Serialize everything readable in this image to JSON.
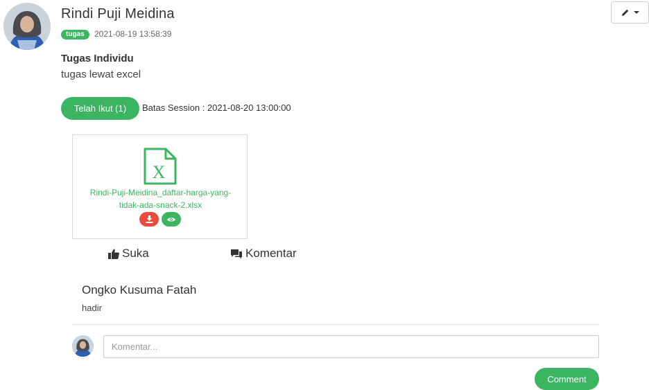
{
  "post": {
    "author": "Rindi Puji Meidina",
    "badge": "tugas",
    "timestamp": "2021-08-19 13:58:39",
    "title": "Tugas Individu",
    "body": "tugas lewat excel",
    "joined_label": "Telah Ikut (1)",
    "session_deadline": "Batas Session : 2021-08-20 13:00:00"
  },
  "attachment": {
    "file_icon": "excel-file-icon",
    "file_name": "Rindi-Puji-Meidina_daftar-harga-yang-tidak-ada-snack-2.xlsx",
    "download_icon": "download-icon",
    "view_icon": "eye-icon"
  },
  "actions": {
    "like_label": "Suka",
    "comment_label": "Komentar"
  },
  "comments": [
    {
      "name": "Ongko Kusuma Fatah",
      "text": "hadir"
    }
  ],
  "comment_form": {
    "placeholder": "Komentar...",
    "value": "",
    "submit_label": "Comment"
  },
  "colors": {
    "accent_green": "#3cb563",
    "danger_red": "#e74c3c"
  }
}
